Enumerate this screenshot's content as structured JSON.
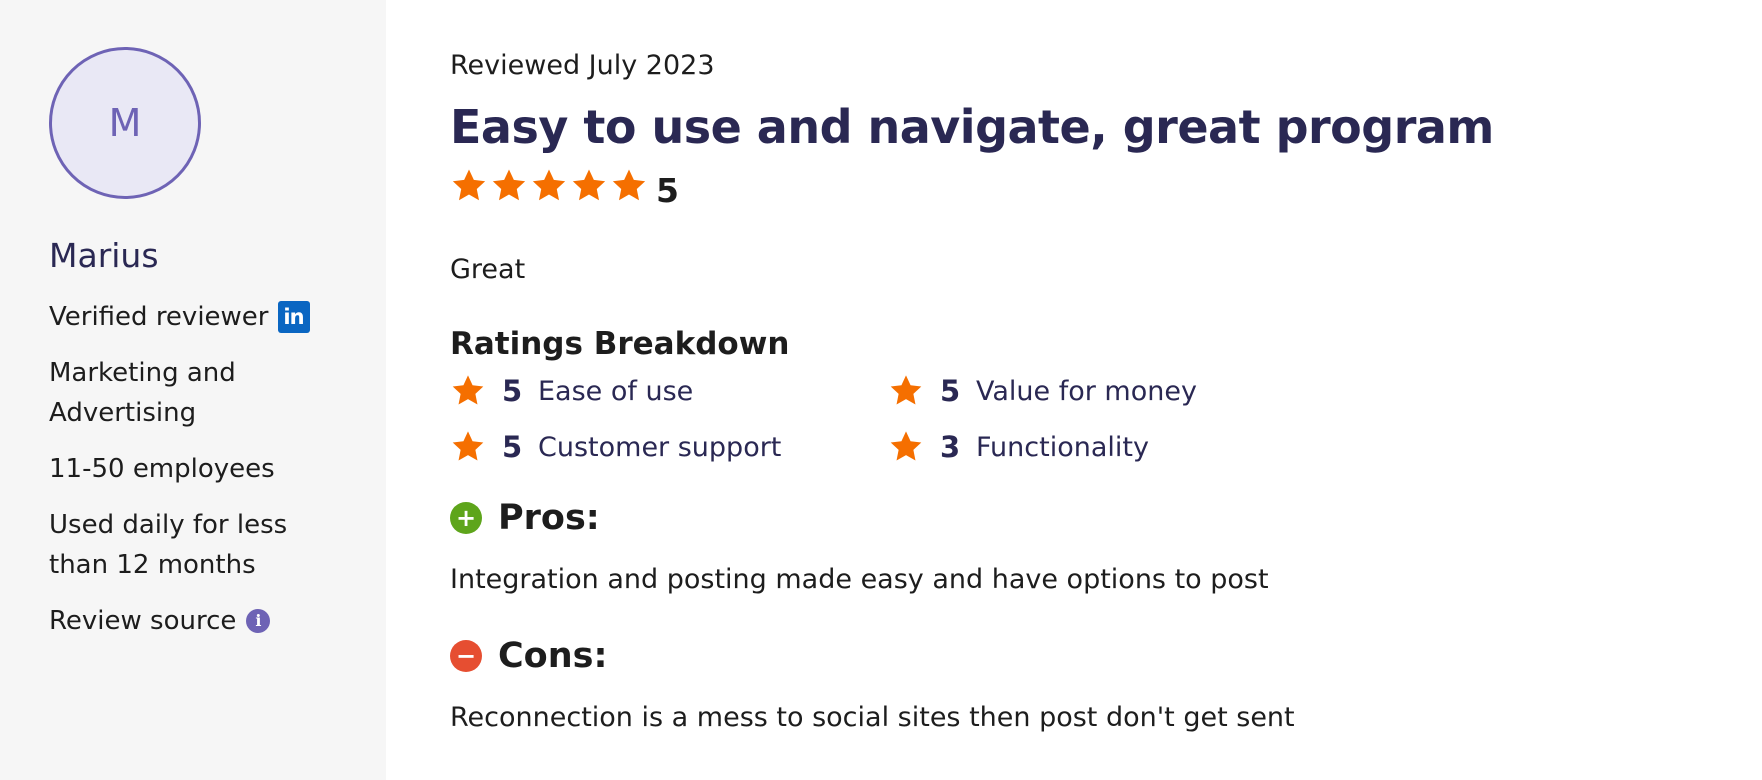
{
  "reviewer": {
    "initial": "M",
    "name": "Marius",
    "verified_label": "Verified reviewer",
    "industry": "Marketing and Advertising",
    "company_size": "11-50 employees",
    "usage": "Used daily for less than 12 months",
    "review_source_label": "Review source"
  },
  "review": {
    "reviewed_date": "Reviewed July 2023",
    "title": "Easy to use and navigate, great program",
    "overall_score": "5",
    "overall_stars": 5,
    "summary": "Great",
    "breakdown_title": "Ratings Breakdown",
    "breakdown": [
      {
        "value": "5",
        "label": "Ease of use"
      },
      {
        "value": "5",
        "label": "Value for money"
      },
      {
        "value": "5",
        "label": "Customer support"
      },
      {
        "value": "3",
        "label": "Functionality"
      }
    ],
    "pros_title": "Pros:",
    "pros_text": "Integration and posting made easy and have options to post",
    "cons_title": "Cons:",
    "cons_text": "Reconnection is a mess to social sites then post don't get sent"
  },
  "icons": {
    "linkedin": "linkedin-icon",
    "info": "info-icon",
    "star": "star-icon",
    "plus": "plus-circle-icon",
    "minus": "minus-circle-icon"
  },
  "colors": {
    "star": "#f56f00",
    "accent_purple": "#6e63b5",
    "heading_navy": "#2a2853",
    "pros_green": "#5ea51b",
    "cons_red": "#e64e31",
    "linkedin_blue": "#0a66c2"
  }
}
